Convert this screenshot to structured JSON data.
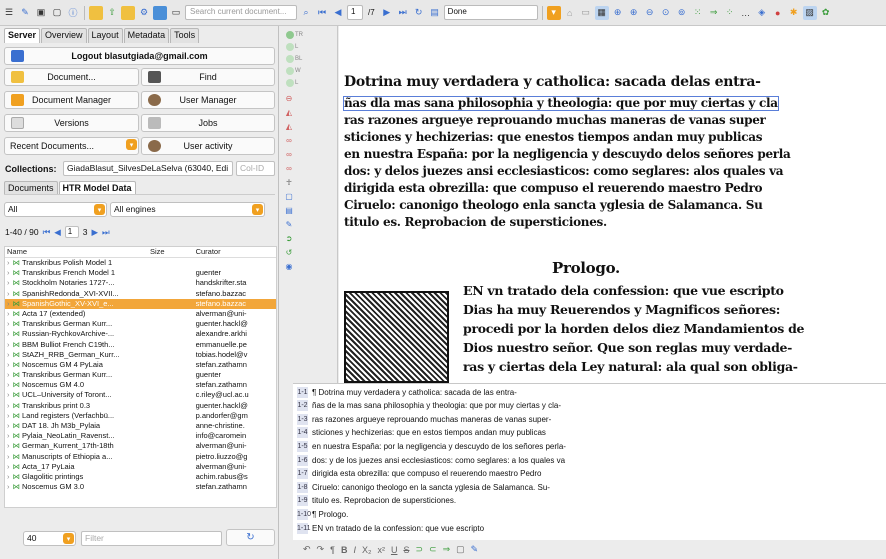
{
  "toolbar": {
    "search_placeholder": "Search current document...",
    "page_current": "1",
    "page_total": "/7",
    "status": "Done"
  },
  "tabs": [
    "Server",
    "Overview",
    "Layout",
    "Metadata",
    "Tools"
  ],
  "server": {
    "logout_label": "Logout blasutgiada@gmail.com",
    "buttons": {
      "document": "Document...",
      "find": "Find",
      "document_manager": "Document Manager",
      "user_manager": "User Manager",
      "versions": "Versions",
      "jobs": "Jobs",
      "recent_documents": "Recent Documents...",
      "user_activity": "User activity"
    },
    "collections_label": "Collections:",
    "collection_value": "GiadaBlasut_SilvesDeLaSelva (63040, Edi",
    "col_id_placeholder": "Col-ID"
  },
  "subtabs": [
    "Documents",
    "HTR Model Data"
  ],
  "filters": {
    "scope": "All",
    "engine": "All engines"
  },
  "pagination": {
    "range": "1-40 / 90",
    "page": "1",
    "of": "3"
  },
  "table": {
    "headers": [
      "Name",
      "Size",
      "Curator"
    ],
    "rows": [
      {
        "name": "Transkribus Polish Model 1",
        "size": "",
        "curator": ""
      },
      {
        "name": "Transkribus French Model 1",
        "size": "",
        "curator": "guenter"
      },
      {
        "name": "Stockholm Notaries 1727-...",
        "size": "",
        "curator": "handskrifter.sta"
      },
      {
        "name": "SpanishRedonda_XVI-XVII...",
        "size": "",
        "curator": "stefano.bazzac"
      },
      {
        "name": "SpanishGothic_XV-XVI_e...",
        "size": "",
        "curator": "stefano.bazzac"
      },
      {
        "name": "Acta 17 (extended)",
        "size": "",
        "curator": "alverman@uni-"
      },
      {
        "name": "Transkribus German Kurr...",
        "size": "",
        "curator": "guenter.hackl@"
      },
      {
        "name": "Russian-RychkovArchive-...",
        "size": "",
        "curator": "alexandre.arkhi"
      },
      {
        "name": "BBM Bulliot French C19th...",
        "size": "",
        "curator": "emmanuelle.pe"
      },
      {
        "name": "StAZH_RRB_German_Kurr...",
        "size": "",
        "curator": "tobias.hodel@v"
      },
      {
        "name": "Noscemus GM 4 PyLaia",
        "size": "",
        "curator": "stefan.zathamn"
      },
      {
        "name": "Transkribus German Kurr...",
        "size": "",
        "curator": "guenter"
      },
      {
        "name": "Noscemus GM 4.0",
        "size": "",
        "curator": "stefan.zathamn"
      },
      {
        "name": "UCL–University of Toront...",
        "size": "",
        "curator": "c.riley@ucl.ac.u"
      },
      {
        "name": "Transkribus print 0.3",
        "size": "",
        "curator": "guenter.hackl@"
      },
      {
        "name": "Land registers (Verfachbü...",
        "size": "",
        "curator": "p.andorfer@gm"
      },
      {
        "name": "DAT 18. Jh M3b_Pylaia",
        "size": "",
        "curator": "anne-christine."
      },
      {
        "name": "Pylaia_NeoLatin_Ravenst...",
        "size": "",
        "curator": "info@caromein"
      },
      {
        "name": "German_Kurrent_17th-18th",
        "size": "",
        "curator": "alverman@uni-"
      },
      {
        "name": "Manuscripts of Ethiopia a...",
        "size": "",
        "curator": "pietro.liuzzo@g"
      },
      {
        "name": "Acta_17 PyLaia",
        "size": "",
        "curator": "alverman@uni-"
      },
      {
        "name": "Glagolitic printings",
        "size": "",
        "curator": "achim.rabus@s"
      },
      {
        "name": "Noscemus GM 3.0",
        "size": "",
        "curator": "stefan.zathamn"
      }
    ]
  },
  "bottom": {
    "count": "40",
    "filter_placeholder": "Filter"
  },
  "side_labels": [
    "TR",
    "L",
    "BL",
    "W",
    "L"
  ],
  "page_image_lines": [
    "Dotrina muy verdadera y catholica: sacada delas entra-",
    "ñas dla mas sana philosophia y theologia: que por muy ciertas y cla",
    "ras razones argueye reprouando muchas maneras de vanas super",
    "sticiones y hechizerias: que enestos tiempos andan muy publicas",
    "en nuestra España: por la negligencia y descuydo delos señores perla",
    "dos: y delos juezes ansi ecclesiasticos: como seglares: alos quales va",
    "dirigida esta obrezilla: que compuso el reuerendo maestro Pedro",
    "Ciruelo: canonigo theologo enla sancta yglesia de Salamanca. Su",
    "titulo es. Reprobacion de supersticiones.",
    "Prologo.",
    "EN vn tratado dela confession: que vue escripto",
    "Dias ha muy Reuerendos y Magnificos señores:",
    "procedi por la horden delos diez Mandamientos de",
    "Dios nuestro señor. Que son reglas muy verdade-",
    "ras y ciertas dela Ley natural: ala qual son obliga-"
  ],
  "transcription": [
    {
      "n": "1-1",
      "text": "¶ Dotrina muy verdadera y catholica: sacada de las entra-"
    },
    {
      "n": "1-2",
      "text": "ñas de la mas sana philosophia y theologia: que por muy ciertas y cla-"
    },
    {
      "n": "1-3",
      "text": "ras razones argueye reprouando muchas maneras de vanas super-"
    },
    {
      "n": "1-4",
      "text": "sticiones y hechizerias: que en estos tiempos andan muy publicas"
    },
    {
      "n": "1-5",
      "text": "en nuestra España: por la negligencia y descuydo de los señores perla-"
    },
    {
      "n": "1-6",
      "text": "dos: y de los juezes ansi ecclesiasticos: como seglares: a los quales va"
    },
    {
      "n": "1-7",
      "text": "dirigida esta obrezilla: que compuso el reuerendo maestro Pedro"
    },
    {
      "n": "1-8",
      "text": "Ciruelo: canonigo theologo en la sancta yglesia de Salamanca. Su-"
    },
    {
      "n": "1-9",
      "text": "titulo es. Reprobacion de supersticiones."
    },
    {
      "n": "1-10",
      "text": "¶ Prologo."
    },
    {
      "n": "1-11",
      "text": "EN vn tratado de la confession: que vue escripto"
    }
  ],
  "colors": {
    "accent": "#f2a63a",
    "highlight": "#5a7ed8"
  }
}
